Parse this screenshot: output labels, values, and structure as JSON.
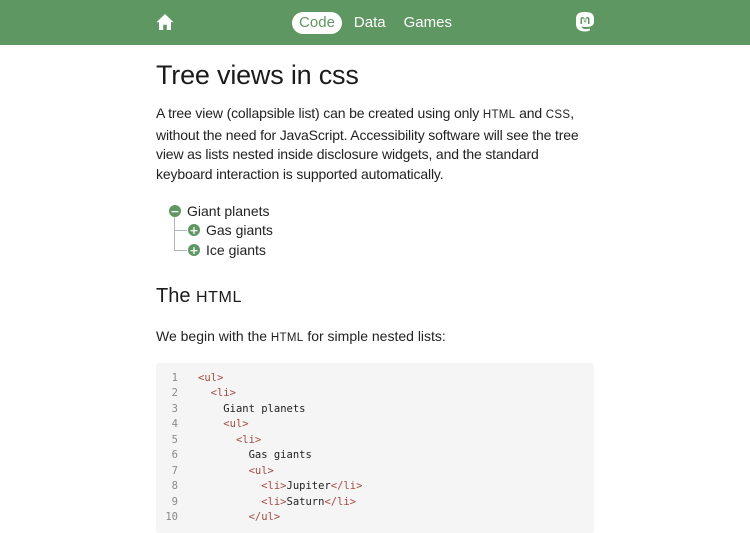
{
  "nav": {
    "home_icon": "home-icon",
    "links": [
      "Code",
      "Data",
      "Games"
    ],
    "active": "Code",
    "mastodon_icon": "mastodon-icon",
    "bar_color": "#5f9762"
  },
  "article": {
    "title": "Tree views in css",
    "intro_parts": [
      "A tree view (collapsible list) can be created using only ",
      "html",
      " and ",
      "css",
      ", without the need for JavaScript. Accessibility software will see the tree view as lists nested inside disclosure widgets, and the standard keyboard interaction is supported automatically."
    ],
    "tree": {
      "root": "Giant planets",
      "children": [
        "Gas giants",
        "Ice giants"
      ],
      "root_icon": "minus",
      "child_icon": "plus"
    },
    "section_heading": "The html",
    "section_heading_parts": [
      "The ",
      "html"
    ],
    "section_para_parts": [
      "We begin with the ",
      "html",
      " for simple nested lists:"
    ]
  },
  "code_block": {
    "lines": [
      {
        "n": "1",
        "indent": "",
        "parts": [
          {
            "t": "tag",
            "v": "<ul>"
          }
        ]
      },
      {
        "n": "2",
        "indent": "  ",
        "parts": [
          {
            "t": "tag",
            "v": "<li>"
          }
        ]
      },
      {
        "n": "3",
        "indent": "    ",
        "parts": [
          {
            "t": "text",
            "v": "Giant planets"
          }
        ]
      },
      {
        "n": "4",
        "indent": "    ",
        "parts": [
          {
            "t": "tag",
            "v": "<ul>"
          }
        ]
      },
      {
        "n": "5",
        "indent": "      ",
        "parts": [
          {
            "t": "tag",
            "v": "<li>"
          }
        ]
      },
      {
        "n": "6",
        "indent": "        ",
        "parts": [
          {
            "t": "text",
            "v": "Gas giants"
          }
        ]
      },
      {
        "n": "7",
        "indent": "        ",
        "parts": [
          {
            "t": "tag",
            "v": "<ul>"
          }
        ]
      },
      {
        "n": "8",
        "indent": "          ",
        "parts": [
          {
            "t": "tag",
            "v": "<li>"
          },
          {
            "t": "text",
            "v": "Jupiter"
          },
          {
            "t": "tag",
            "v": "</li>"
          }
        ]
      },
      {
        "n": "9",
        "indent": "          ",
        "parts": [
          {
            "t": "tag",
            "v": "<li>"
          },
          {
            "t": "text",
            "v": "Saturn"
          },
          {
            "t": "tag",
            "v": "</li>"
          }
        ]
      },
      {
        "n": "10",
        "indent": "        ",
        "parts": [
          {
            "t": "tag",
            "v": "</ul>"
          }
        ]
      }
    ]
  }
}
